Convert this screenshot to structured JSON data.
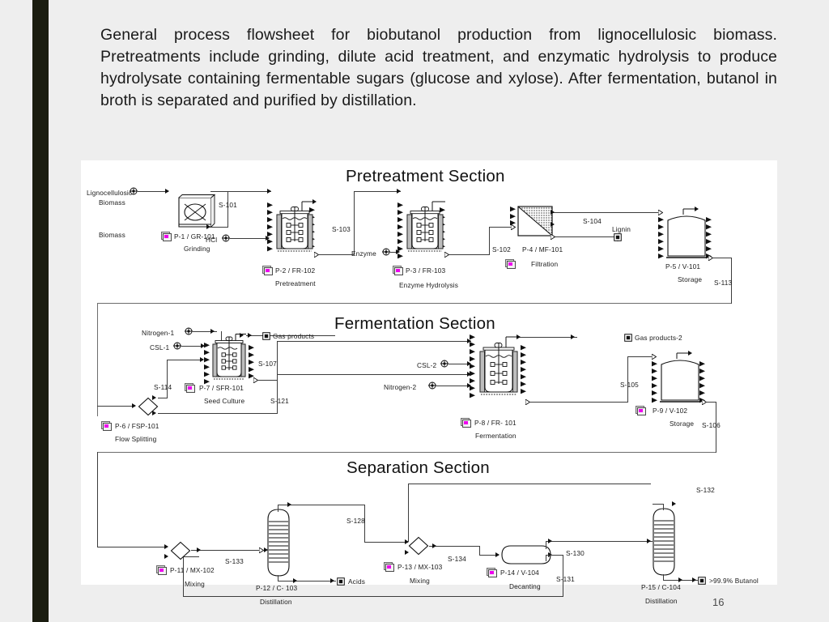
{
  "slide": {
    "caption": "General process flowsheet for biobutanol production from lignocellulosic biomass. Pretreatments include grinding, dilute acid treatment, and enzymatic hydrolysis to produce hydrolysate containing fermentable sugars (glucose and xylose). After fermentation, butanol in broth is separated and purified by distillation.",
    "page_number": "16",
    "accent_bar_color": "#1b1d10",
    "background_color": "#eeeeee",
    "panel_color": "#ffffff",
    "icon_accent_color": "#ee00ee"
  },
  "diagram": {
    "sections": [
      {
        "id": "pretreatment",
        "title": "Pretreatment Section"
      },
      {
        "id": "fermentation",
        "title": "Fermentation Section"
      },
      {
        "id": "separation",
        "title": "Separation Section"
      }
    ],
    "pretreatment": {
      "inputs": [
        {
          "name": "feed-lignocellulosic-biomass",
          "line1": "Lignocellulosic",
          "line2": "Biomass"
        },
        {
          "name": "feed-biomass",
          "line1": "Biomass",
          "line2": ""
        },
        {
          "name": "feed-hcl",
          "line1": "HCl",
          "line2": ""
        },
        {
          "name": "feed-enzyme",
          "line1": "Enzyme",
          "line2": ""
        }
      ],
      "outputs": [
        {
          "name": "product-lignin",
          "label": "Lignin"
        }
      ],
      "units": [
        {
          "name": "unit-gr-101",
          "tag": "P-1 / GR-101",
          "desc": "Grinding",
          "icon": "grinder-icon"
        },
        {
          "name": "unit-fr-102",
          "tag": "P-2 / FR-102",
          "desc": "Pretreatment",
          "icon": "stirred-reactor-icon"
        },
        {
          "name": "unit-fr-103",
          "tag": "P-3 / FR-103",
          "desc": "Enzyme Hydrolysis",
          "icon": "stirred-reactor-icon"
        },
        {
          "name": "unit-mf-101",
          "tag": "P-4 / MF-101",
          "desc": "Filtration",
          "icon": "filter-icon"
        },
        {
          "name": "unit-v-101",
          "tag": "P-5 / V-101",
          "desc": "Storage",
          "icon": "storage-tank-icon"
        }
      ],
      "streams": [
        "S-101",
        "S-103",
        "S-102",
        "S-104",
        "S-113"
      ]
    },
    "fermentation": {
      "inputs": [
        {
          "name": "feed-nitrogen-1",
          "line1": "Nitrogen-1",
          "line2": ""
        },
        {
          "name": "feed-csl-1",
          "line1": "CSL-1",
          "line2": ""
        },
        {
          "name": "feed-csl-2",
          "line1": "CSL-2",
          "line2": ""
        },
        {
          "name": "feed-nitrogen-2",
          "line1": "Nitrogen-2",
          "line2": ""
        }
      ],
      "outputs": [
        {
          "name": "product-gas-products",
          "label": "Gas products"
        },
        {
          "name": "product-gas-products-2",
          "label": "Gas products-2"
        }
      ],
      "units": [
        {
          "name": "unit-fsp-101",
          "tag": "P-6 / FSP-101",
          "desc": "Flow Splitting",
          "icon": "flow-splitter-icon"
        },
        {
          "name": "unit-sfr-101",
          "tag": "P-7 / SFR-101",
          "desc": "Seed Culture",
          "icon": "stirred-reactor-icon"
        },
        {
          "name": "unit-fr-101",
          "tag": "P-8 / FR- 101",
          "desc": "Fermentation",
          "icon": "stirred-reactor-icon"
        },
        {
          "name": "unit-v-102",
          "tag": "P-9 / V-102",
          "desc": "Storage",
          "icon": "storage-tank-icon"
        }
      ],
      "streams": [
        "S-107",
        "S-114",
        "S-121",
        "S-105",
        "S-106"
      ]
    },
    "separation": {
      "inputs": [],
      "outputs": [
        {
          "name": "product-acids",
          "label": "Acids"
        },
        {
          "name": "product-butanol",
          "label": ">99.9% Butanol"
        }
      ],
      "units": [
        {
          "name": "unit-mx-102",
          "tag": "P-11 / MX-102",
          "desc": "Mixing",
          "icon": "mixer-icon"
        },
        {
          "name": "unit-c-103",
          "tag": "P-12 / C- 103",
          "desc": "Distillation",
          "icon": "distillation-column-icon"
        },
        {
          "name": "unit-mx-103",
          "tag": "P-13 / MX-103",
          "desc": "Mixing",
          "icon": "mixer-icon"
        },
        {
          "name": "unit-v-104",
          "tag": "P-14 / V-104",
          "desc": "Decanting",
          "icon": "decanter-icon"
        },
        {
          "name": "unit-c-104",
          "tag": "P-15 / C-104",
          "desc": "Distillation",
          "icon": "distillation-column-icon"
        }
      ],
      "streams": [
        "S-133",
        "S-128",
        "S-134",
        "S-130",
        "S-131",
        "S-132"
      ]
    }
  }
}
